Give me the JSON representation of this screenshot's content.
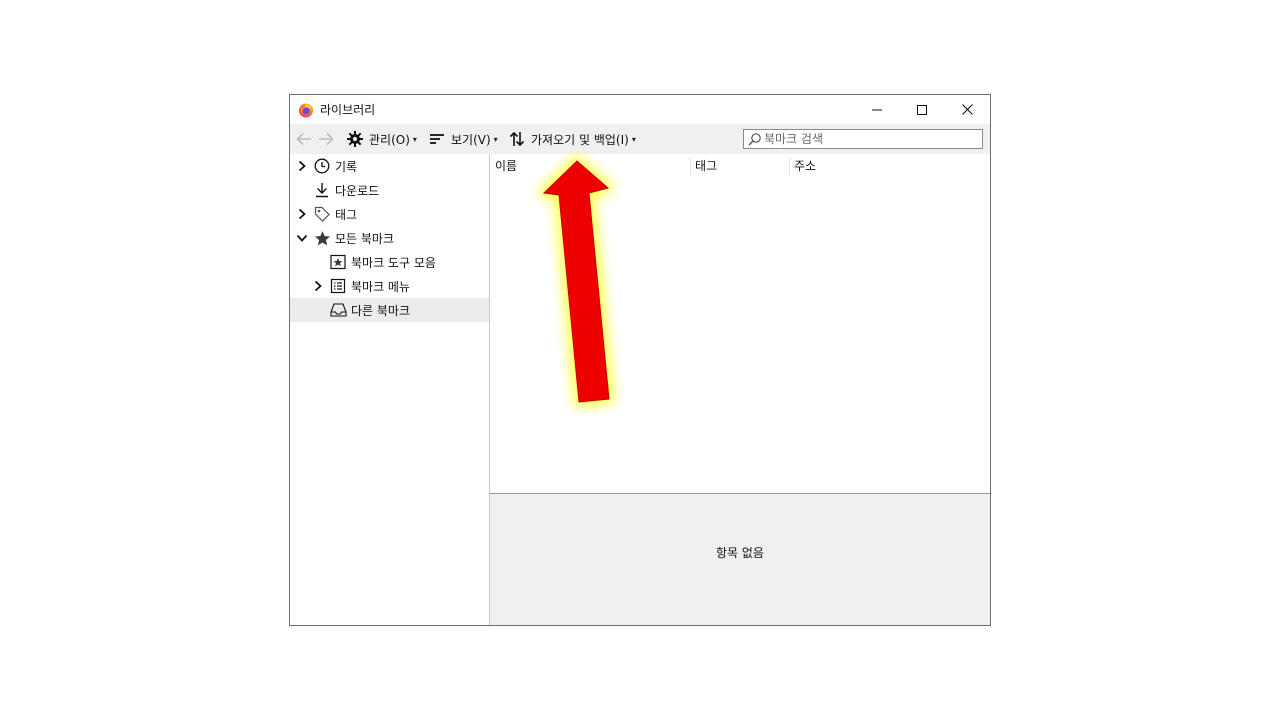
{
  "window": {
    "title": "라이브러리",
    "controls": [
      "minimize",
      "maximize",
      "close"
    ]
  },
  "toolbar": {
    "back_icon": "back-arrow-icon",
    "forward_icon": "forward-arrow-icon",
    "organize_label": "관리(O)",
    "views_label": "보기(V)",
    "import_backup_label": "가져오기 및 백업(I)",
    "search_placeholder": "북마크 검색"
  },
  "sidebar": {
    "items": [
      {
        "label": "기록",
        "icon": "history-clock-icon",
        "expandable": true,
        "expanded": false
      },
      {
        "label": "다운로드",
        "icon": "download-icon",
        "expandable": false
      },
      {
        "label": "태그",
        "icon": "tag-icon",
        "expandable": true,
        "expanded": false
      },
      {
        "label": "모든 북마크",
        "icon": "star-icon",
        "expandable": true,
        "expanded": true
      },
      {
        "label": "북마크 도구 모음",
        "icon": "bookmarks-toolbar-icon",
        "expandable": false
      },
      {
        "label": "북마크 메뉴",
        "icon": "bookmarks-menu-icon",
        "expandable": true,
        "expanded": false
      },
      {
        "label": "다른 북마크",
        "icon": "other-bookmarks-icon",
        "expandable": false,
        "selected": true
      }
    ]
  },
  "list": {
    "columns": [
      "이름",
      "태그",
      "주소"
    ]
  },
  "details": {
    "empty_text": "항목 없음"
  },
  "annotation": {
    "arrow_color": "#ee0000",
    "glow_color": "#ffff3a"
  }
}
